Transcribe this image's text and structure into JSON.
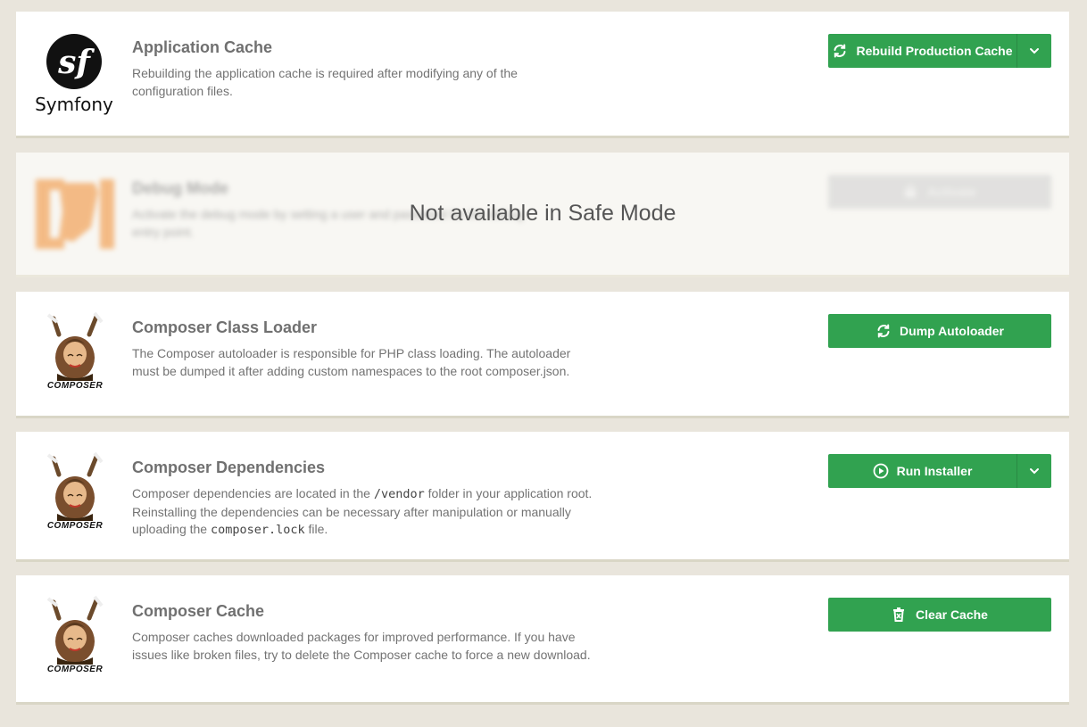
{
  "cards": [
    {
      "id": "application-cache",
      "title": "Application Cache",
      "description": "Rebuilding the application cache is required after modifying any of the configuration files.",
      "logo": "symfony-logo",
      "logo_text": "Symfony",
      "button": {
        "label": "Rebuild Production Cache",
        "icon": "refresh-icon",
        "has_dropdown": true
      }
    },
    {
      "id": "debug-mode",
      "title": "Debug Mode",
      "description": "Activate the debug mode by setting a user and password for the debug entry point.",
      "logo": "contao-logo",
      "button": {
        "label": "Activate",
        "icon": "lock-icon",
        "has_dropdown": false
      },
      "overlay": "Not available in Safe Mode",
      "disabled": true
    },
    {
      "id": "composer-class-loader",
      "title": "Composer Class Loader",
      "description": "The Composer autoloader is responsible for PHP class loading. The autoloader must be dumped it after adding custom namespaces to the root composer.json.",
      "logo": "composer-logo",
      "logo_text": "COMPOSER",
      "button": {
        "label": "Dump Autoloader",
        "icon": "refresh-icon",
        "has_dropdown": false
      }
    },
    {
      "id": "composer-dependencies",
      "title": "Composer Dependencies",
      "description_parts": [
        "Composer dependencies are located in the ",
        "/vendor",
        " folder in your application root. Reinstalling the dependencies can be necessary after manipulation or manually uploading the ",
        "composer.lock",
        " file."
      ],
      "logo": "composer-logo",
      "logo_text": "COMPOSER",
      "button": {
        "label": "Run Installer",
        "icon": "play-circle-icon",
        "has_dropdown": true
      }
    },
    {
      "id": "composer-cache",
      "title": "Composer Cache",
      "description": "Composer caches downloaded packages for improved performance. If you have issues like broken files, try to delete the Composer cache to force a new download.",
      "logo": "composer-logo",
      "logo_text": "COMPOSER",
      "button": {
        "label": "Clear Cache",
        "icon": "trash-icon",
        "has_dropdown": false
      }
    }
  ],
  "colors": {
    "background": "#e9e5dc",
    "card": "#ffffff",
    "button_green": "#31a250",
    "button_disabled": "#cfcfcf",
    "title_text": "#707070",
    "body_text": "#737373"
  }
}
